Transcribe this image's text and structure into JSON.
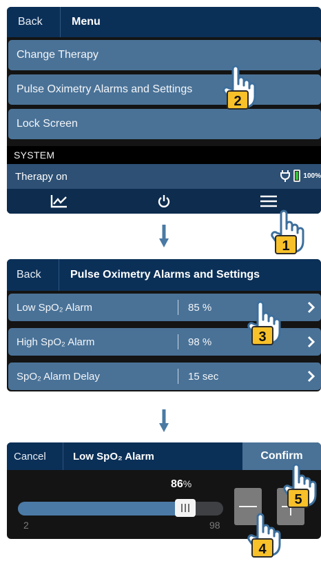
{
  "panel1": {
    "header": {
      "back_label": "Back",
      "title": "Menu"
    },
    "menu_items": [
      "Change Therapy",
      "Pulse Oximetry Alarms and Settings",
      "Lock Screen"
    ],
    "section_label": "SYSTEM",
    "status": {
      "text": "Therapy on",
      "battery_percent": "100%"
    },
    "nav_icons": [
      "chart-icon",
      "power-icon",
      "menu-icon"
    ]
  },
  "panel2": {
    "header": {
      "back_label": "Back",
      "title": "Pulse Oximetry Alarms and Settings"
    },
    "rows": [
      {
        "label": "Low SpO₂ Alarm",
        "value": "85 %"
      },
      {
        "label": "High SpO₂ Alarm",
        "value": "98 %"
      },
      {
        "label": "SpO₂ Alarm Delay",
        "value": "15 sec"
      }
    ]
  },
  "panel3": {
    "header": {
      "cancel_label": "Cancel",
      "title": "Low SpO₂ Alarm",
      "confirm_label": "Confirm"
    },
    "slider": {
      "value": "86",
      "unit": "%",
      "min": "2",
      "max": "98",
      "fraction": 0.8
    }
  },
  "callouts": [
    "1",
    "2",
    "3",
    "4",
    "5"
  ],
  "colors": {
    "header": "#0b3058",
    "item": "#4a7297",
    "accent_fill": "#4b7aa6",
    "arrow": "#4a7aa3"
  }
}
